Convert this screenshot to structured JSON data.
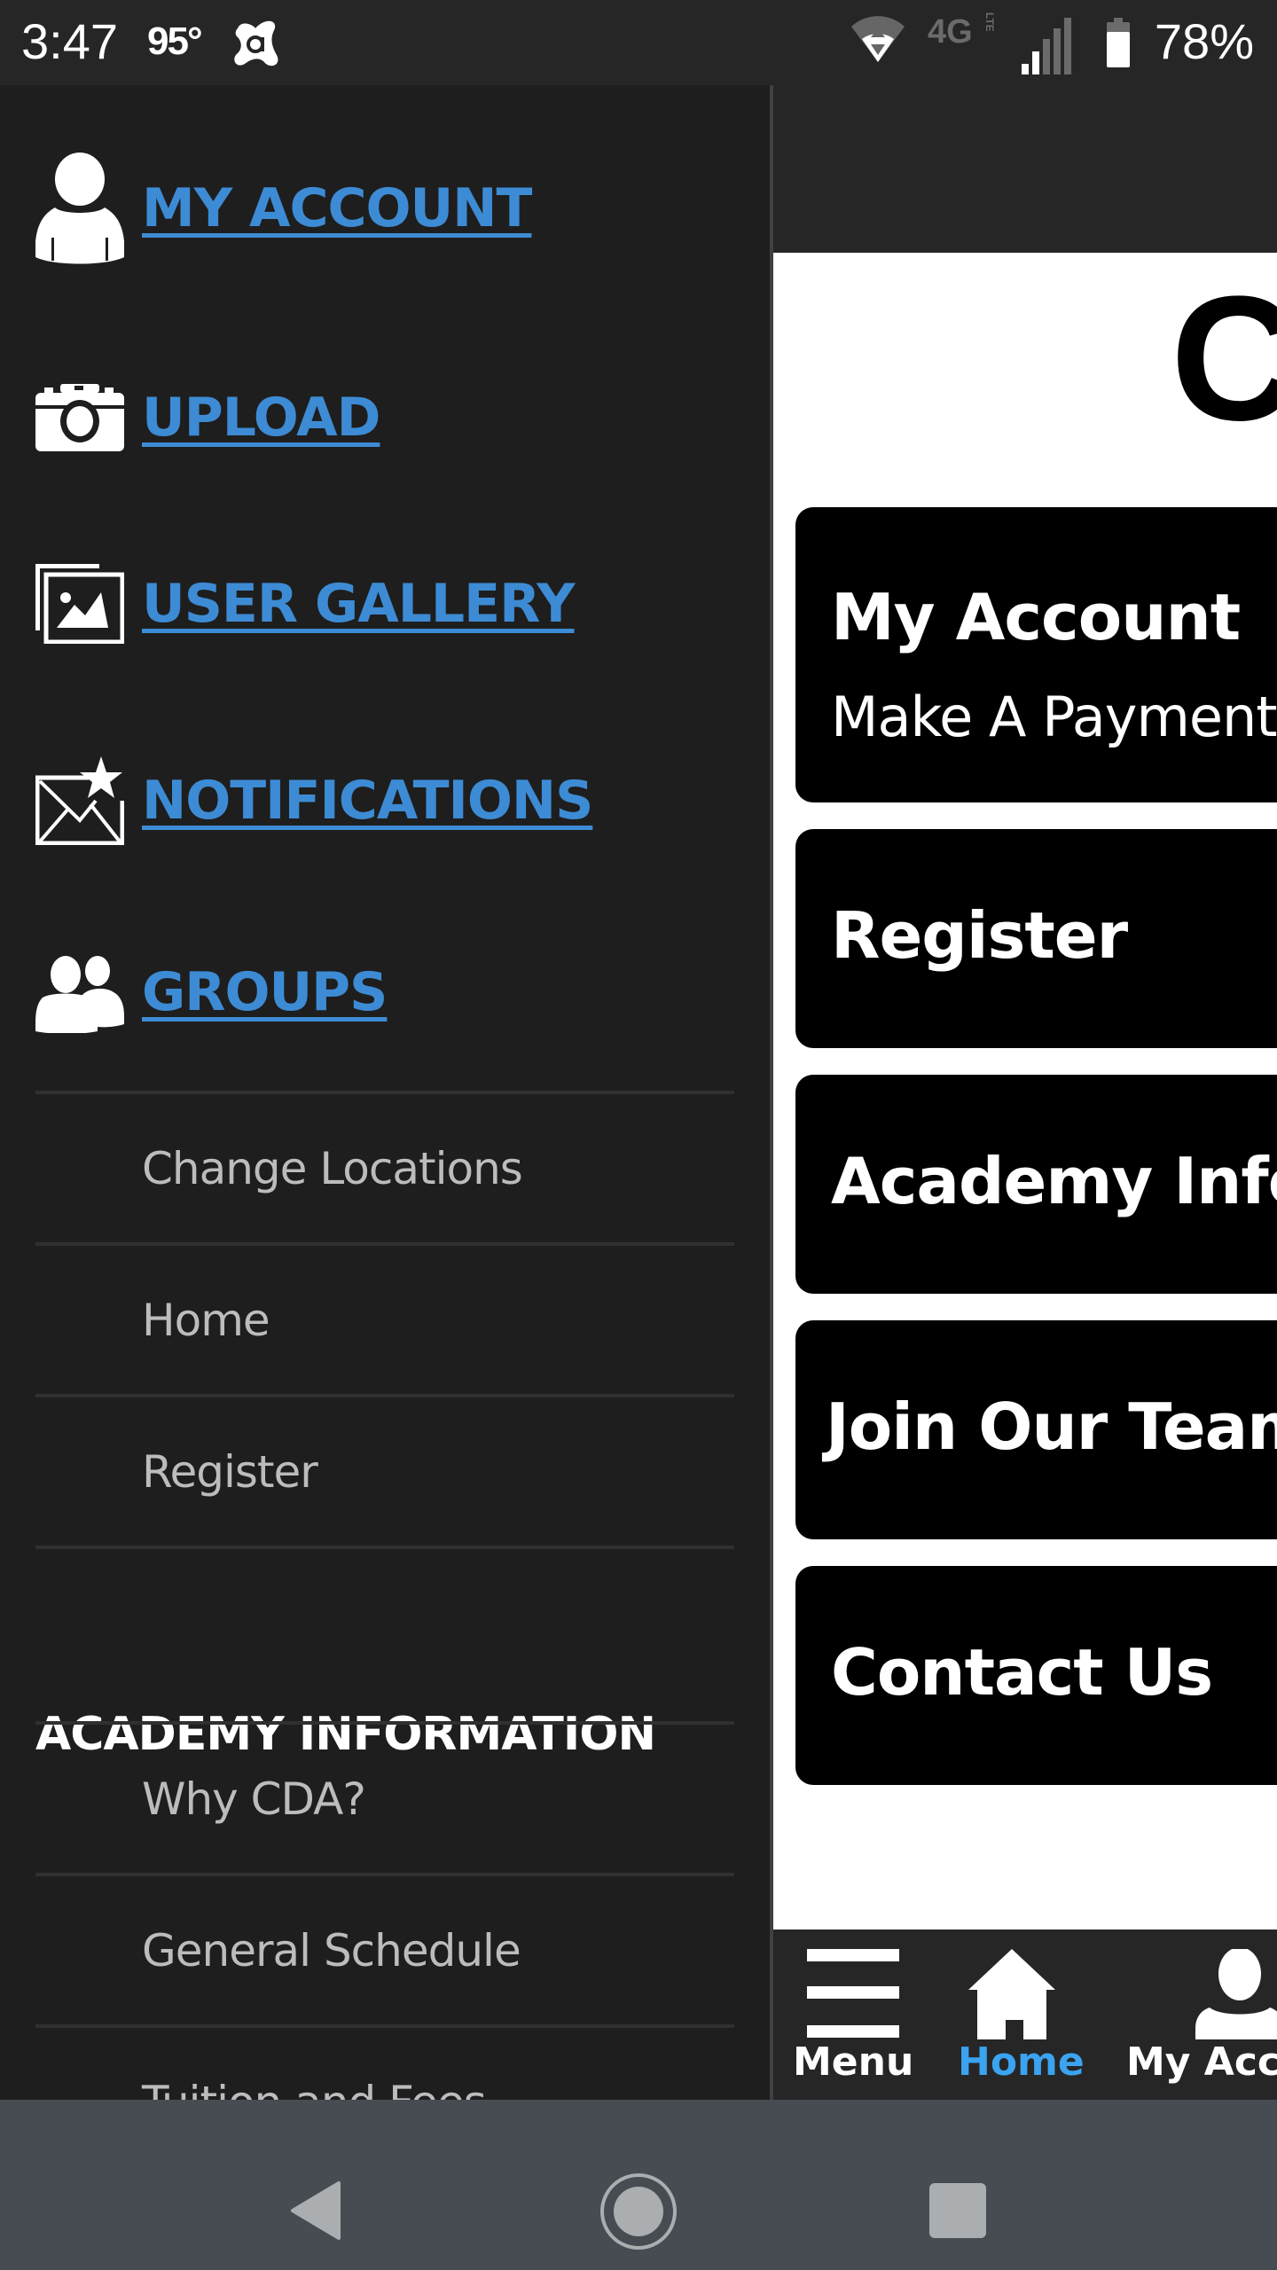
{
  "status_bar": {
    "time": "3:47",
    "temperature": "95°",
    "notification_icon": "avast-icon",
    "network_type": "4G LTE",
    "battery_percent": "78%",
    "battery_level": 0.78
  },
  "drawer": {
    "main_items": [
      {
        "label": "MY ACCOUNT",
        "icon": "user-icon"
      },
      {
        "label": "UPLOAD",
        "icon": "camera-icon"
      },
      {
        "label": "USER GALLERY",
        "icon": "gallery-icon"
      },
      {
        "label": "NOTIFICATIONS",
        "icon": "mail-star-icon"
      },
      {
        "label": "GROUPS",
        "icon": "groups-icon"
      }
    ],
    "links": [
      {
        "label": "Change Locations"
      },
      {
        "label": "Home"
      },
      {
        "label": "Register"
      }
    ],
    "section_heading": "ACADEMY INFORMATION",
    "section_links": [
      {
        "label": "Why CDA?"
      },
      {
        "label": "General Schedule"
      },
      {
        "label": "Tuition and Fees"
      }
    ]
  },
  "content": {
    "heading_partial": "C",
    "cards": [
      {
        "title": "My Account",
        "subtitle": "Make A Payment"
      },
      {
        "title": "Register",
        "subtitle": ""
      },
      {
        "title": "Academy Info",
        "subtitle": ""
      },
      {
        "title": "Join Our Team",
        "subtitle": ""
      },
      {
        "title": "Contact Us",
        "subtitle": ""
      }
    ]
  },
  "bottom_nav": {
    "items": [
      {
        "label": "Menu",
        "icon": "hamburger-icon",
        "active": false
      },
      {
        "label": "Home",
        "icon": "home-icon",
        "active": true
      },
      {
        "label": "My Account",
        "icon": "user-icon",
        "active": false
      }
    ]
  },
  "colors": {
    "link_blue": "#3d8bd4",
    "active_tab_blue": "#3ba3f0",
    "drawer_bg": "#1e1e1e",
    "card_bg": "#000000"
  }
}
